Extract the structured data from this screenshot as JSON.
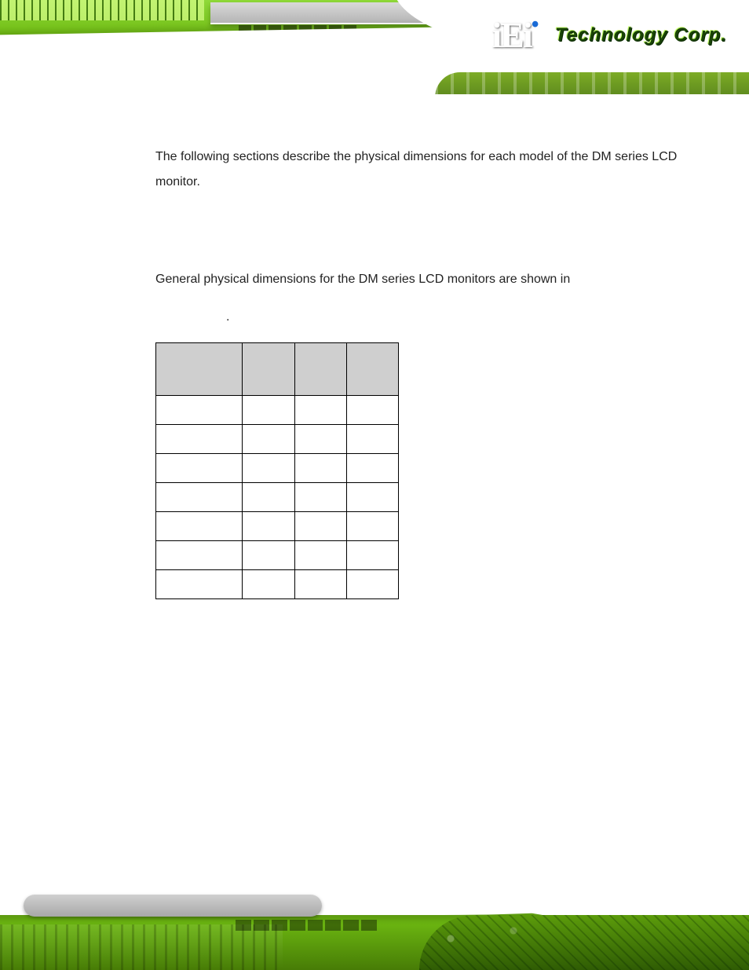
{
  "logo": {
    "mark": "iEi",
    "registered": "®",
    "text": "Technology Corp."
  },
  "content": {
    "para1": "The following sections describe the physical dimensions for each model of the DM series LCD monitor.",
    "para2": "General physical dimensions for the DM series LCD monitors are shown in",
    "period": "."
  },
  "table": {
    "headers": [
      "",
      "",
      "",
      ""
    ],
    "rows": [
      [
        "",
        "",
        "",
        ""
      ],
      [
        "",
        "",
        "",
        ""
      ],
      [
        "",
        "",
        "",
        ""
      ],
      [
        "",
        "",
        "",
        ""
      ],
      [
        "",
        "",
        "",
        ""
      ],
      [
        "",
        "",
        "",
        ""
      ],
      [
        "",
        "",
        "",
        ""
      ]
    ]
  }
}
